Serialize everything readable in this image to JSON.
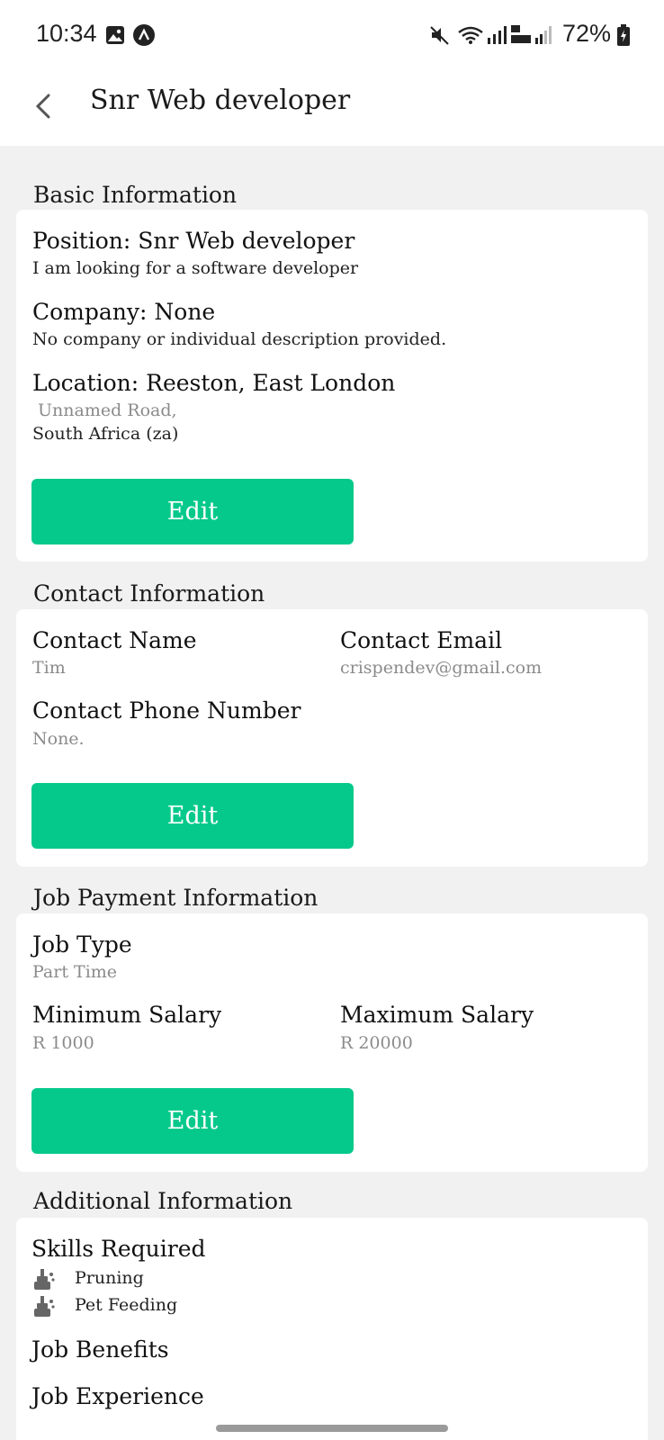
{
  "status_bar": {
    "time": "10:34",
    "battery": "72%"
  },
  "app_bar": {
    "title": "Snr Web developer"
  },
  "basic": {
    "section_title": "Basic Information",
    "position": "Position: Snr Web developer",
    "position_desc": "I am looking for a software developer",
    "company": "Company: None",
    "company_desc": "No company or individual description provided.",
    "location": "Location: Reeston, East London",
    "address_line": "Unnamed Road,",
    "country": "South Africa (za)",
    "edit_label": "Edit"
  },
  "contact": {
    "section_title": "Contact Information",
    "name_label": "Contact Name",
    "name_value": "Tim",
    "email_label": "Contact Email",
    "email_value": "crispendev@gmail.com",
    "phone_label": "Contact Phone Number",
    "phone_value": "None.",
    "edit_label": "Edit"
  },
  "payment": {
    "section_title": "Job Payment Information",
    "type_label": "Job Type",
    "type_value": "Part Time",
    "min_label": "Minimum Salary",
    "min_value": "R 1000",
    "max_label": "Maximum Salary",
    "max_value": "R 20000",
    "edit_label": "Edit"
  },
  "additional": {
    "section_title": "Additional Information",
    "skills_label": "Skills Required",
    "skills": [
      "Pruning",
      "Pet Feeding"
    ],
    "benefits_label": "Job Benefits",
    "experience_label": "Job Experience"
  },
  "colors": {
    "accent": "#05c98a",
    "background": "#f1f1f1",
    "muted_text": "#8b8b8b"
  },
  "icons": [
    "image-icon",
    "app-notification-icon",
    "mute-icon",
    "wifi-icon",
    "signal-icon",
    "battery-icon",
    "back-arrow-icon",
    "skill-icon"
  ]
}
